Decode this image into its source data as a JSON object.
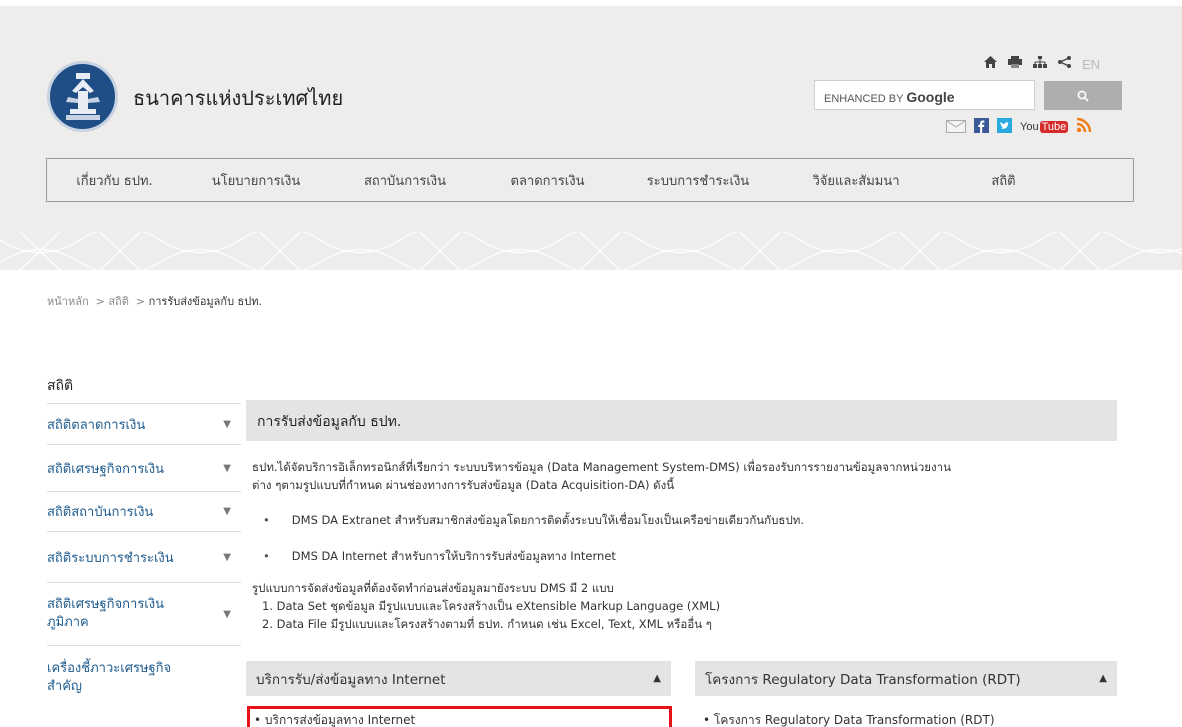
{
  "header": {
    "site_title": "ธนาคารแห่งประเทศไทย",
    "lang_link": "EN",
    "search": {
      "placeholder_prefix": "ENHANCED BY",
      "placeholder_brand": "Google"
    },
    "icons": [
      "home-icon",
      "print-icon",
      "sitemap-icon",
      "share-icon"
    ],
    "social": [
      "email-icon",
      "facebook-icon",
      "twitter-icon",
      "youtube-icon",
      "rss-icon"
    ],
    "youtube_label_a": "You",
    "youtube_label_b": "Tube"
  },
  "nav": {
    "items": [
      "เกี่ยวกับ ธปท.",
      "นโยบายการเงิน",
      "สถาบันการเงิน",
      "ตลาดการเงิน",
      "ระบบการชำระเงิน",
      "วิจัยและสัมมนา",
      "สถิติ"
    ]
  },
  "breadcrumb": {
    "home": "หน้าหลัก",
    "sep1": ">",
    "level1": "สถิติ",
    "sep2": ">",
    "current": "การรับส่งข้อมูลกับ ธปท."
  },
  "sidebar": {
    "heading": "สถิติ",
    "items": [
      {
        "label": "สถิติตลาดการเงิน",
        "label2": ""
      },
      {
        "label": "สถิติเศรษฐกิจการเงิน",
        "label2": ""
      },
      {
        "label": "สถิติสถาบันการเงิน",
        "label2": ""
      },
      {
        "label": "สถิติระบบการชำระเงิน",
        "label2": ""
      },
      {
        "label": "สถิติเศรษฐกิจการเงิน",
        "label2": "ภูมิภาค"
      },
      {
        "label": "เครื่องชี้ภาวะเศรษฐกิจ",
        "label2": "สำคัญ"
      }
    ]
  },
  "main": {
    "title": "การรับส่งข้อมูลกับ ธปท.",
    "intro_line1": "ธปท.ได้จัดบริการอิเล็กทรอนิกส์ที่เรียกว่า ระบบบริหารข้อมูล (Data Management System-DMS) เพื่อรองรับการรายงานข้อมูลจากหน่วยงาน",
    "intro_line2": "ต่าง ๆตามรูปแบบที่กำหนด  ผ่านช่องทางการรับส่งข้อมูล (Data Acquisition-DA)  ดังนี้",
    "bullets": [
      "DMS DA Extranet  สำหรับสมาชิกส่งข้อมูลโดยการติดตั้งระบบให้เชื่อมโยงเป็นเครือข่ายเดียวกันกับธปท.",
      "DMS DA Internet  สำหรับการให้บริการรับส่งข้อมูลทาง Internet"
    ],
    "format_intro": "รูปแบบการจัดส่งข้อมูลที่ต้องจัดทำก่อนส่งข้อมูลมายังระบบ DMS มี 2 แบบ",
    "formats": [
      "1. Data Set ชุดข้อมูล มีรูปแบบและโครงสร้างเป็น eXtensible Markup Language (XML)",
      "2. Data File มีรูปแบบและโครงสร้างตามที่ ธปท. กำหนด เช่น Excel, Text, XML หรืออื่น ๆ"
    ],
    "panel_left": {
      "title": "บริการรับ/ส่งข้อมูลทาง Internet",
      "item": "• บริการส่งข้อมูลทาง Internet"
    },
    "panel_right": {
      "title": "โครงการ Regulatory Data Transformation (RDT)",
      "item": "• โครงการ Regulatory Data Transformation (RDT)"
    }
  },
  "colors": {
    "accent_blue": "#1f5c8f",
    "highlight_red": "#e8111a",
    "panel_gray": "#e4e4e4"
  }
}
